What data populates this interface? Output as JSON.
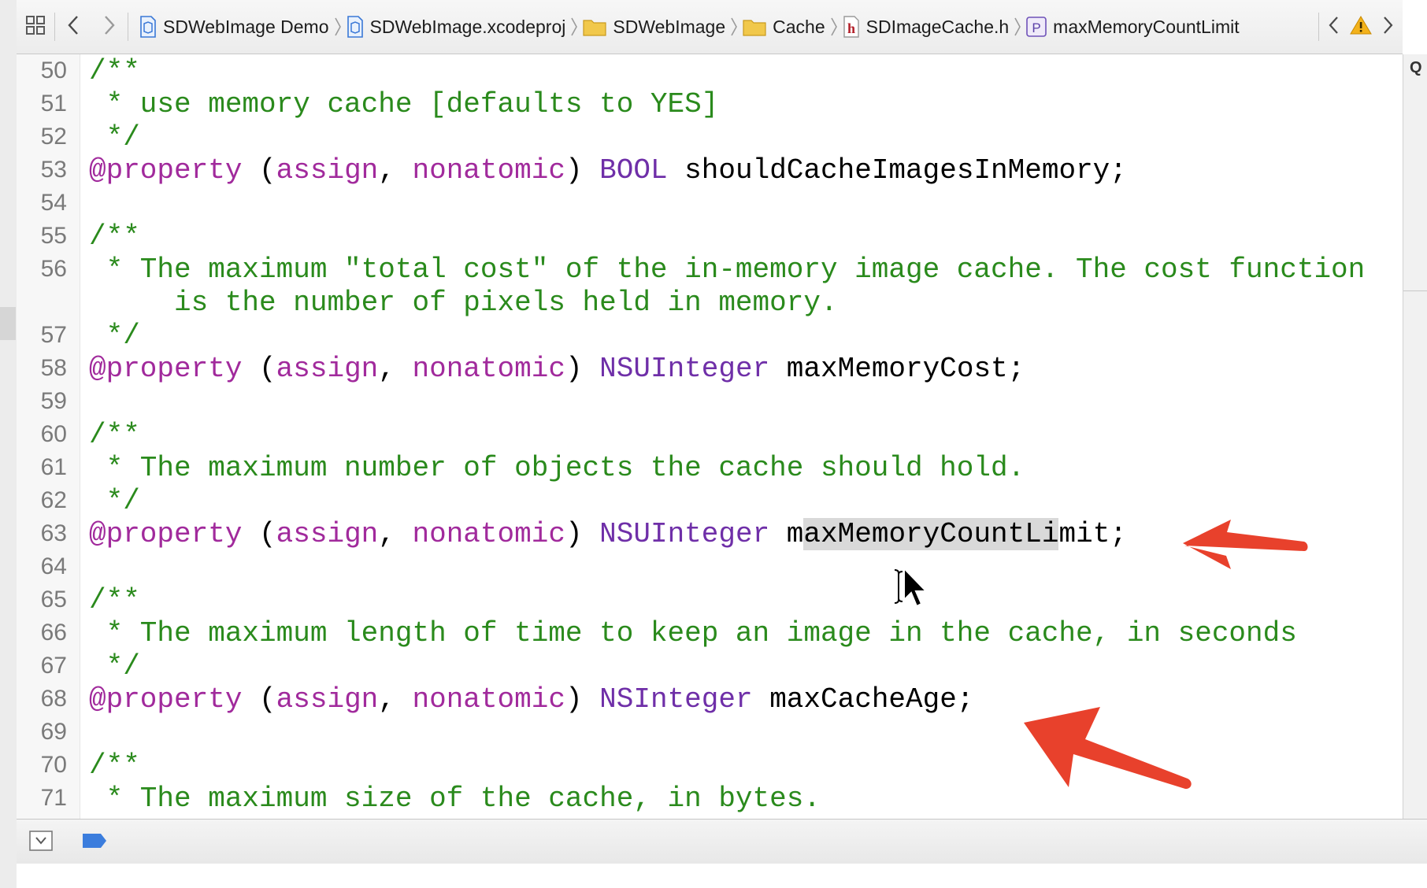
{
  "jump_bar": {
    "breadcrumbs": [
      {
        "label": "SDWebImage Demo",
        "icon": "project-icon"
      },
      {
        "label": "SDWebImage.xcodeproj",
        "icon": "project-icon"
      },
      {
        "label": "SDWebImage",
        "icon": "folder-icon"
      },
      {
        "label": "Cache",
        "icon": "folder-icon"
      },
      {
        "label": "SDImageCache.h",
        "icon": "header-file-icon"
      },
      {
        "label": "maxMemoryCountLimit",
        "icon": "property-icon"
      }
    ],
    "property_icon_letter": "P",
    "header_icon_letter": "h"
  },
  "right_strip": {
    "label": "Q"
  },
  "code_lines": [
    {
      "n": "50",
      "tokens": [
        [
          "comment",
          "/**"
        ]
      ]
    },
    {
      "n": "51",
      "tokens": [
        [
          "comment",
          " * use memory cache [defaults to YES]"
        ]
      ]
    },
    {
      "n": "52",
      "tokens": [
        [
          "comment",
          " */"
        ]
      ]
    },
    {
      "n": "53",
      "tokens": [
        [
          "kw",
          "@property"
        ],
        [
          "plain",
          " ("
        ],
        [
          "kw",
          "assign"
        ],
        [
          "plain",
          ", "
        ],
        [
          "kw",
          "nonatomic"
        ],
        [
          "plain",
          ") "
        ],
        [
          "type",
          "BOOL"
        ],
        [
          "plain",
          " shouldCacheImagesInMemory;"
        ]
      ]
    },
    {
      "n": "54",
      "tokens": []
    },
    {
      "n": "55",
      "tokens": [
        [
          "comment",
          "/**"
        ]
      ]
    },
    {
      "n": "56",
      "tokens": [
        [
          "comment",
          " * The maximum \"total cost\" of the in-memory image cache. The cost function"
        ]
      ]
    },
    {
      "n": "",
      "tokens": [
        [
          "comment",
          "     is the number of pixels held in memory."
        ]
      ]
    },
    {
      "n": "57",
      "tokens": [
        [
          "comment",
          " */"
        ]
      ]
    },
    {
      "n": "58",
      "tokens": [
        [
          "kw",
          "@property"
        ],
        [
          "plain",
          " ("
        ],
        [
          "kw",
          "assign"
        ],
        [
          "plain",
          ", "
        ],
        [
          "kw",
          "nonatomic"
        ],
        [
          "plain",
          ") "
        ],
        [
          "type",
          "NSUInteger"
        ],
        [
          "plain",
          " maxMemoryCost;"
        ]
      ]
    },
    {
      "n": "59",
      "tokens": []
    },
    {
      "n": "60",
      "tokens": [
        [
          "comment",
          "/**"
        ]
      ]
    },
    {
      "n": "61",
      "tokens": [
        [
          "comment",
          " * The maximum number of objects the cache should hold."
        ]
      ]
    },
    {
      "n": "62",
      "tokens": [
        [
          "comment",
          " */"
        ]
      ]
    },
    {
      "n": "63",
      "tokens": [
        [
          "kw",
          "@property"
        ],
        [
          "plain",
          " ("
        ],
        [
          "kw",
          "assign"
        ],
        [
          "plain",
          ", "
        ],
        [
          "kw",
          "nonatomic"
        ],
        [
          "plain",
          ") "
        ],
        [
          "type",
          "NSUInteger"
        ],
        [
          "plain",
          " m"
        ],
        [
          "sel",
          "axMemoryCountLi"
        ],
        [
          "plain",
          "mit;"
        ]
      ]
    },
    {
      "n": "64",
      "tokens": []
    },
    {
      "n": "65",
      "tokens": [
        [
          "comment",
          "/**"
        ]
      ]
    },
    {
      "n": "66",
      "tokens": [
        [
          "comment",
          " * The maximum length of time to keep an image in the cache, in seconds"
        ]
      ]
    },
    {
      "n": "67",
      "tokens": [
        [
          "comment",
          " */"
        ]
      ]
    },
    {
      "n": "68",
      "tokens": [
        [
          "kw",
          "@property"
        ],
        [
          "plain",
          " ("
        ],
        [
          "kw",
          "assign"
        ],
        [
          "plain",
          ", "
        ],
        [
          "kw",
          "nonatomic"
        ],
        [
          "plain",
          ") "
        ],
        [
          "type",
          "NSInteger"
        ],
        [
          "plain",
          " maxCacheAge;"
        ]
      ]
    },
    {
      "n": "69",
      "tokens": []
    },
    {
      "n": "70",
      "tokens": [
        [
          "comment",
          "/**"
        ]
      ]
    },
    {
      "n": "71",
      "tokens": [
        [
          "comment",
          " * The maximum size of the cache, in bytes."
        ]
      ]
    }
  ],
  "colors": {
    "comment": "#2a8a1c",
    "keyword": "#a12a9c",
    "type": "#6f2fa8",
    "annotation_arrow": "#e8412c",
    "warning": "#f3b21b",
    "breakpoint_tag": "#3b7ddd"
  }
}
